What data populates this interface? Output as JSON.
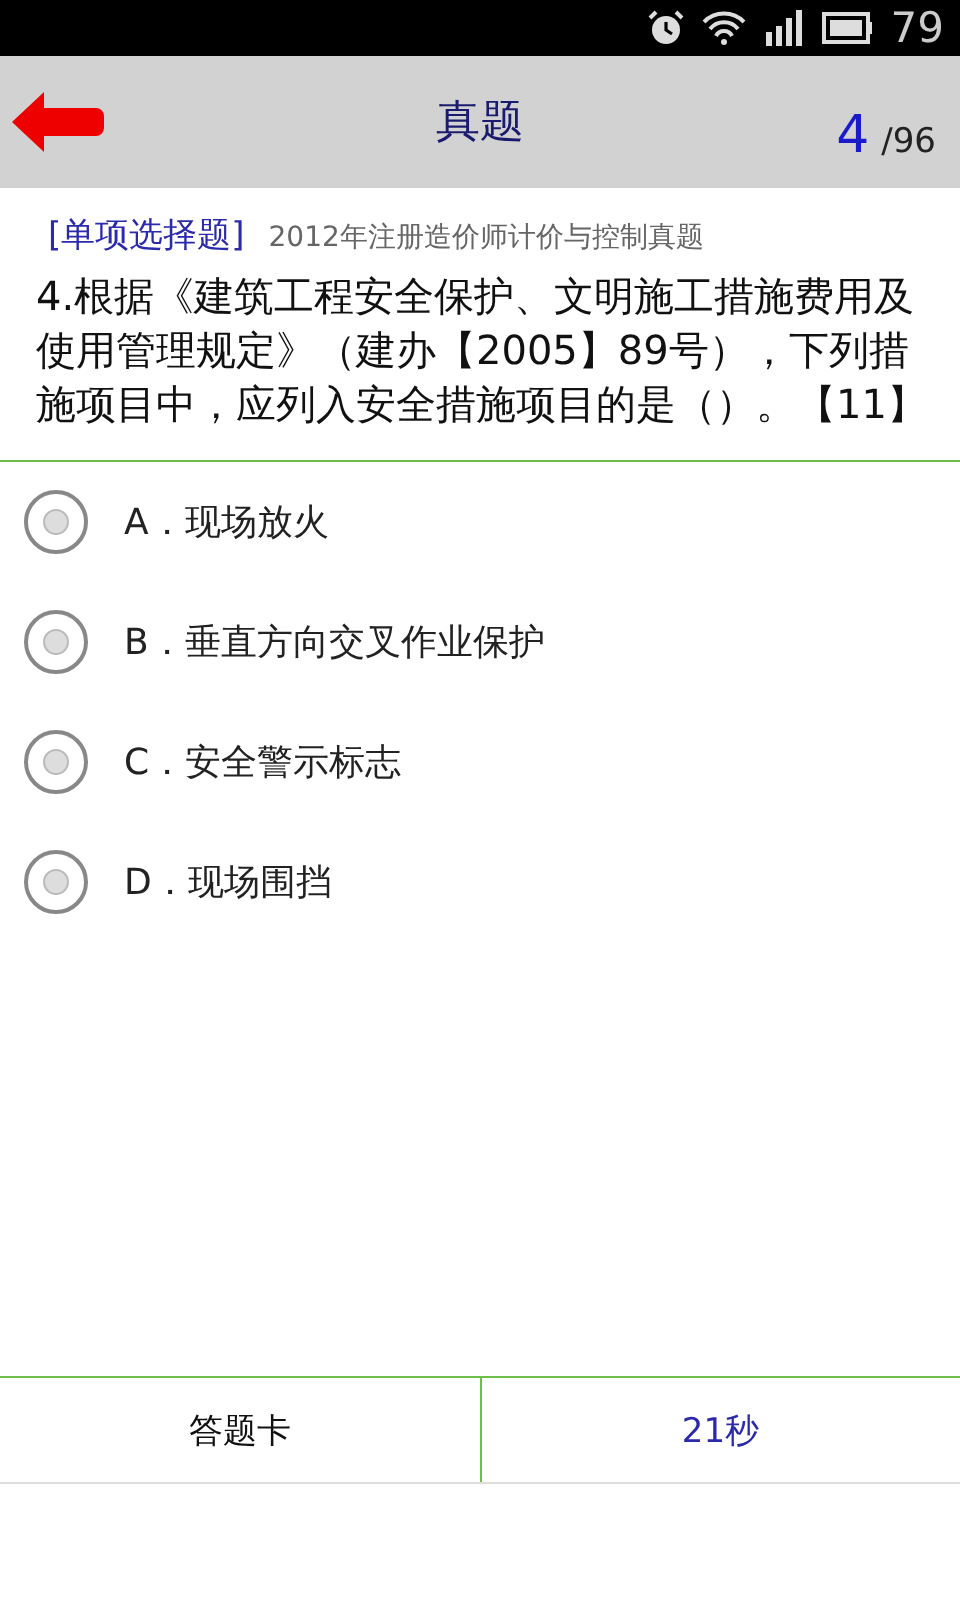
{
  "status_bar": {
    "battery": "79"
  },
  "header": {
    "title": "真题",
    "current": "4",
    "total": "/96"
  },
  "question": {
    "type": "[单项选择题]",
    "source": "2012年注册造价师计价与控制真题",
    "text": "4.根据《建筑工程安全保护、文明施工措施费用及使用管理规定》（建办【2005】89号），下列措施项目中，应列入安全措施项目的是（）。【11】"
  },
  "options": [
    {
      "label": "A．现场放火",
      "selected": false
    },
    {
      "label": "B．垂直方向交叉作业保护",
      "selected": false
    },
    {
      "label": "C．安全警示标志",
      "selected": false
    },
    {
      "label": "D．现场围挡",
      "selected": false
    }
  ],
  "bottom_bar": {
    "answer_card": "答题卡",
    "timer": "21秒"
  }
}
